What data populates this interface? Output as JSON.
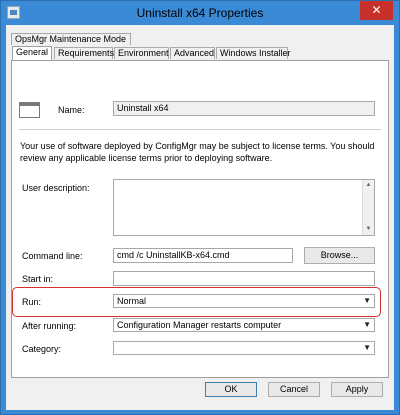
{
  "window": {
    "title": "Uninstall x64 Properties",
    "close_glyph": "✕"
  },
  "tabs_top": [
    {
      "label": "OpsMgr Maintenance Mode"
    }
  ],
  "tabs_bottom": [
    {
      "label": "General"
    },
    {
      "label": "Requirements"
    },
    {
      "label": "Environment"
    },
    {
      "label": "Advanced"
    },
    {
      "label": "Windows Installer"
    }
  ],
  "general": {
    "name_label": "Name:",
    "name_value": "Uninstall x64",
    "license_text": "Your use of software deployed by ConfigMgr may be subject to license terms. You should review any applicable license terms prior to deploying software.",
    "user_description_label": "User description:",
    "user_description_value": "",
    "command_line_label": "Command line:",
    "command_line_value": "cmd /c UninstallKB-x64.cmd",
    "browse_label": "Browse...",
    "start_in_label": "Start in:",
    "start_in_value": "",
    "run_label": "Run:",
    "run_value": "Normal",
    "after_running_label": "After running:",
    "after_running_value": "Configuration Manager restarts computer",
    "category_label": "Category:",
    "category_value": ""
  },
  "buttons": {
    "ok": "OK",
    "cancel": "Cancel",
    "apply": "Apply"
  },
  "colors": {
    "titlebar": "#3b8ad6",
    "close": "#c7312c",
    "highlight": "#d33030"
  }
}
